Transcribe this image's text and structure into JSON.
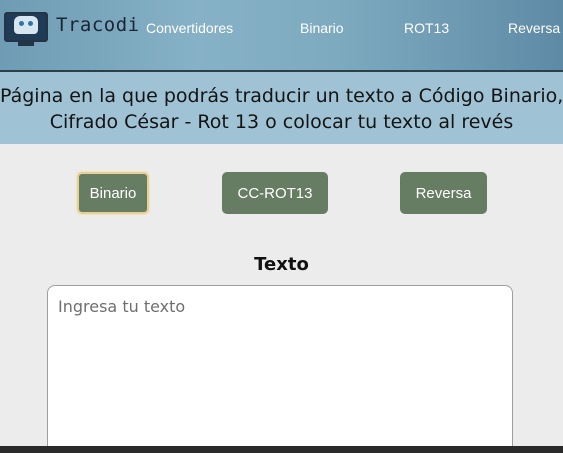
{
  "nav": {
    "brand": "Tracodi",
    "links": [
      "Convertidores",
      "Binario",
      "ROT13",
      "Reversa"
    ]
  },
  "hero": {
    "line1": "Página en la que podrás traducir un texto a Código Binario,",
    "line2": "Cifrado César - Rot 13 o colocar tu texto al revés"
  },
  "modes": {
    "binario": "Binario",
    "rot13": "CC-ROT13",
    "reversa": "Reversa",
    "active": "Binario"
  },
  "input": {
    "label": "Texto",
    "placeholder": "Ingresa tu texto",
    "value": ""
  },
  "colors": {
    "nav_bg": "#7eaac0",
    "hero_bg": "#9fc3d4",
    "button_bg": "#667c63",
    "active_border": "#e8cf9a",
    "page_bg": "#ececec"
  },
  "icons": {
    "logo": "robot-monitor-icon"
  }
}
